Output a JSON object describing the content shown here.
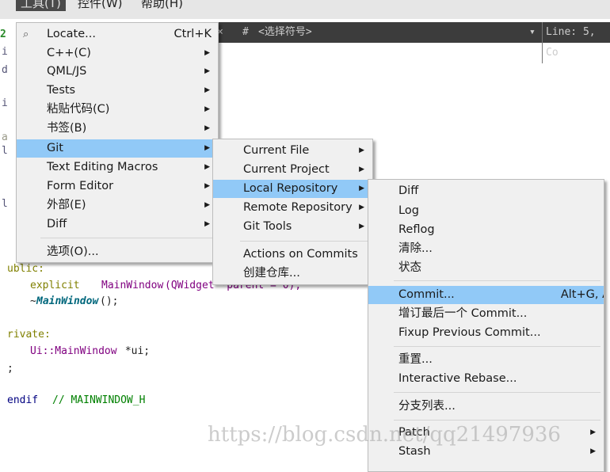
{
  "menubar": {
    "items": [
      "工具(T)",
      "控件(W)",
      "帮助(H)"
    ]
  },
  "toolbar": {
    "close": "×",
    "hash": "#",
    "symbol": "<选择符号>",
    "dropdown": "▾",
    "position": "Line: 5, Co"
  },
  "tools_menu": {
    "items": [
      {
        "label": "Locate...",
        "shortcut": "Ctrl+K",
        "icon": "search-icon"
      },
      {
        "label": "C++(C)"
      },
      {
        "label": "QML/JS"
      },
      {
        "label": "Tests"
      },
      {
        "label": "粘贴代码(C)"
      },
      {
        "label": "书签(B)"
      },
      {
        "label": "Git",
        "highlighted": true
      },
      {
        "label": "Text Editing Macros"
      },
      {
        "label": "Form Editor"
      },
      {
        "label": "外部(E)"
      },
      {
        "label": "Diff"
      },
      {
        "label": "选项(O)..."
      }
    ]
  },
  "git_menu": {
    "items": [
      {
        "label": "Current File"
      },
      {
        "label": "Current Project"
      },
      {
        "label": "Local Repository",
        "highlighted": true
      },
      {
        "label": "Remote Repository"
      },
      {
        "label": "Git Tools"
      },
      {
        "label": "Actions on Commits"
      },
      {
        "label": "创建仓库..."
      }
    ]
  },
  "local_repo_menu": {
    "items": [
      {
        "label": "Diff"
      },
      {
        "label": "Log"
      },
      {
        "label": "Reflog"
      },
      {
        "label": "清除..."
      },
      {
        "label": "状态"
      },
      {
        "label": "Commit...",
        "shortcut": "Alt+G, Alt+C",
        "highlighted": true
      },
      {
        "label": "增订最后一个 Commit..."
      },
      {
        "label": "Fixup Previous Commit..."
      },
      {
        "label": "重置..."
      },
      {
        "label": "Interactive Rebase..."
      },
      {
        "label": "分支列表..."
      },
      {
        "label": "Patch"
      },
      {
        "label": "Stash"
      }
    ]
  },
  "code": {
    "gutter": [
      "2",
      "i",
      "d",
      "i",
      "a",
      "l",
      "l"
    ],
    "lines": [
      "ublic:",
      "explicit",
      "MainWindow",
      "(QWidget *parent = 0);",
      "~",
      "MainWindow",
      "();",
      "rivate:",
      "Ui::MainWindow",
      " *ui;",
      ";",
      "endif",
      "// MAINWINDOW_H"
    ]
  },
  "watermark": "https://blog.csdn.net/qq21497936",
  "colors": {
    "highlight": "#91c9f7",
    "keyword": "#808000",
    "type": "#800080",
    "comment": "#008000"
  }
}
